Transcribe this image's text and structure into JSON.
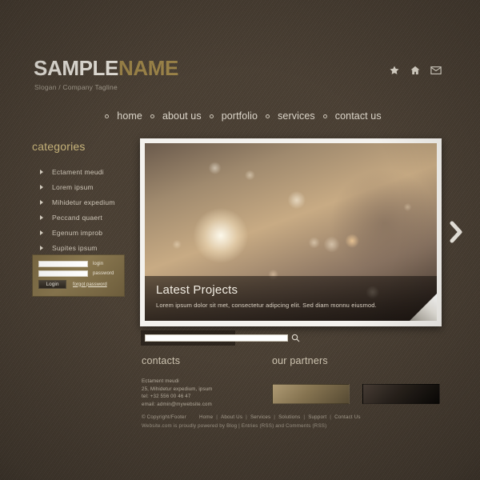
{
  "header": {
    "brand_first": "SAMPLE",
    "brand_second": "NAME",
    "tagline": "Slogan / Company Tagline",
    "social": [
      {
        "name": "star-icon",
        "label": "star"
      },
      {
        "name": "home-icon",
        "label": "home"
      },
      {
        "name": "mail-icon",
        "label": "mail"
      }
    ]
  },
  "nav": {
    "items": [
      {
        "label": "home"
      },
      {
        "label": "about us"
      },
      {
        "label": "portfolio"
      },
      {
        "label": "services"
      },
      {
        "label": "contact us"
      }
    ]
  },
  "sidebar": {
    "title": "categories",
    "items": [
      {
        "label": "Ectament meudi"
      },
      {
        "label": "Lorem ipsum"
      },
      {
        "label": "Mihidetur expedium"
      },
      {
        "label": "Peccand quaert"
      },
      {
        "label": "Egenum improb"
      },
      {
        "label": "Supites ipsum"
      }
    ]
  },
  "login": {
    "user_value": "",
    "user_placeholder": "",
    "user_label": "login",
    "pass_value": "",
    "pass_placeholder": "",
    "pass_label": "password",
    "button": "Login",
    "forgot": "forgot password"
  },
  "slider": {
    "caption_title": "Latest Projects",
    "caption_text": "Lorem ipsum dolor sit met, consectetur adipcing elit. Sed diam monnu eiusmod.",
    "next_label": "next-slide"
  },
  "search": {
    "value": "",
    "placeholder": ""
  },
  "contacts": {
    "title": "contacts",
    "lines": [
      "Ectament meudi",
      "25, Mihidetur expedium, ipsum",
      "tel: +32 556 00 46 47",
      "email: admin@mywebsite.com"
    ]
  },
  "partners": {
    "title": "our partners",
    "logos": [
      {
        "name": "partner-logo-1"
      },
      {
        "name": "partner-logo-2"
      }
    ]
  },
  "footer": {
    "copyright": "© Copyright/Footer",
    "links": [
      "Home",
      "About Us",
      "Services",
      "Solutions",
      "Support",
      "Contact Us"
    ],
    "separator": "|",
    "credit": "Website.com is proudly powered by Blog | Entries (RSS) and Comments (RSS)"
  },
  "colors": {
    "page_bg": "#4a3f33",
    "accent_gold": "#9c8449",
    "brand_light": "#e8e4dc",
    "side_title": "#cdb97e"
  }
}
